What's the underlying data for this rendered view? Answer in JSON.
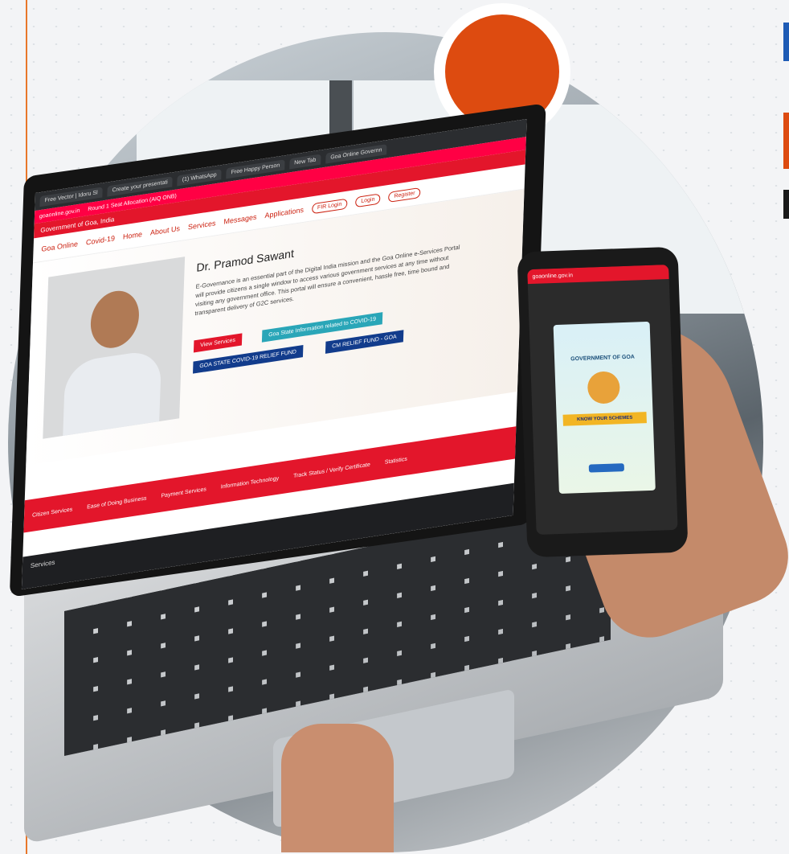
{
  "colors": {
    "accent_orange": "#dd4b10",
    "brand_red": "#e3162b",
    "accent_blue": "#1e5bb5",
    "dark": "#1a1a1a"
  },
  "browser": {
    "tabs": [
      "Free Vector | Idoru Sl",
      "Create your presentati",
      "(1) WhatsApp",
      "Free Happy Person",
      "New Tab",
      "Goa Online Governn"
    ],
    "address": "goaonline.gov.in"
  },
  "site": {
    "top_banner": "Round 1 Seat Allocation (AIQ ONB)",
    "nav_items": [
      "Goa Online",
      "Covid-19",
      "Home",
      "About Us",
      "Services",
      "Messages",
      "Applications"
    ],
    "nav_buttons": [
      "FIR Login",
      "Login",
      "Register"
    ],
    "govt_label": "Government of Goa, India",
    "cm_name": "Dr. Pramod Sawant",
    "intro": "E-Governance is an essential part of the Digital India mission and the Goa Online e-Services Portal will provide citizens a single window to access various government services at any time without visiting any government office. This portal will ensure a convenient, hassle free, time bound and transparent delivery of G2C services.",
    "buttons": {
      "view_services": "View Services",
      "covid_info": "Goa State Information related to COVID-19",
      "relief_fund": "GOA STATE COVID-19 RELIEF FUND",
      "cm_relief": "CM RELIEF FUND - GOA"
    },
    "footer": [
      "Citizen Services",
      "Ease of Doing Business",
      "Payment Services",
      "Information Technology",
      "Track Status / Verify Certificate",
      "Statistics"
    ],
    "taskbar_label": "Services"
  },
  "phone": {
    "address": "goaonline.gov.in",
    "popup_title": "GOVERNMENT OF GOA",
    "popup_band": "KNOW YOUR SCHEMES"
  }
}
